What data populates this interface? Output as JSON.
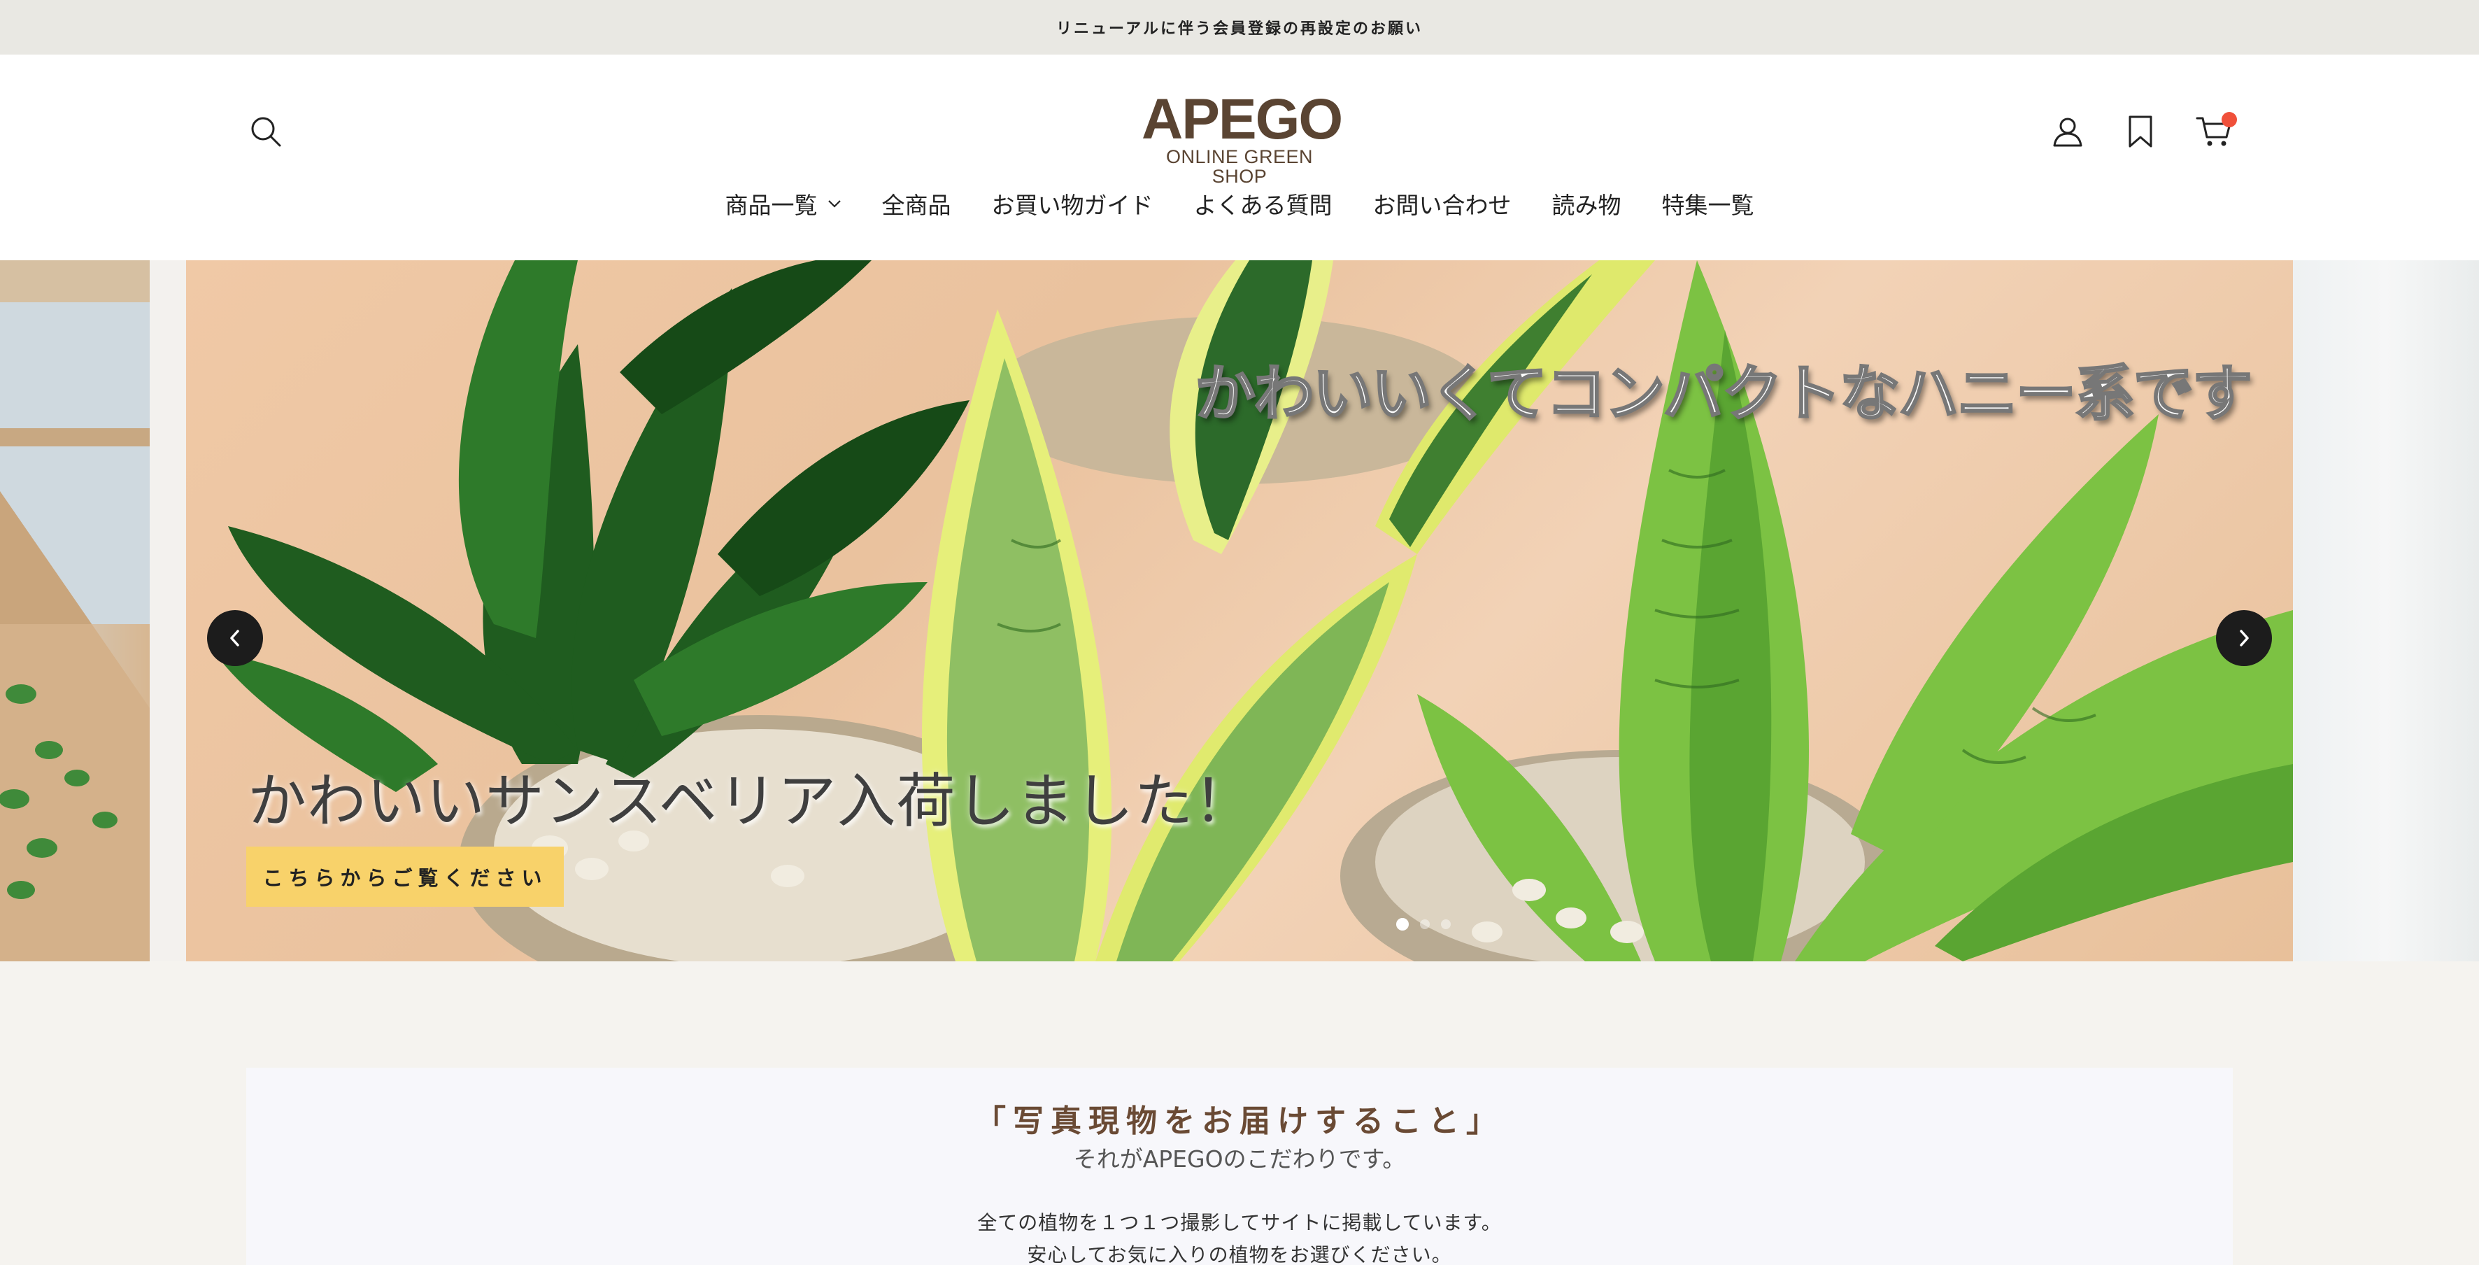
{
  "announcement": {
    "text": "リニューアルに伴う会員登録の再設定のお願い"
  },
  "header": {
    "logo_word": "APEGO",
    "logo_sub": "ONLINE GREEN SHOP",
    "icons": {
      "search": "search-icon",
      "account": "user-icon",
      "wishlist": "bookmark-icon",
      "cart": "cart-icon"
    },
    "cart_badge_color": "#f0503a"
  },
  "nav": {
    "items": [
      {
        "label": "商品一覧",
        "has_dropdown": true
      },
      {
        "label": "全商品"
      },
      {
        "label": "お買い物ガイド"
      },
      {
        "label": "よくある質問"
      },
      {
        "label": "お問い合わせ"
      },
      {
        "label": "読み物"
      },
      {
        "label": "特集一覧"
      }
    ]
  },
  "slideshow": {
    "caption_top": "かわいいくてコンパクトなハニー系です",
    "caption_main": "かわいいサンスベリア入荷しました！",
    "cta_label": "こちらからご覧ください",
    "cta_color": "#f8d26a",
    "current_slide": 1,
    "slide_count": 3
  },
  "promise": {
    "title": "「写真現物をお届けすること」",
    "subtitle": "それがAPEGOのこだわりです。",
    "line1": "全ての植物を１つ１つ撮影してサイトに掲載しています。",
    "line2": "安心してお気に入りの植物をお選びください。"
  }
}
